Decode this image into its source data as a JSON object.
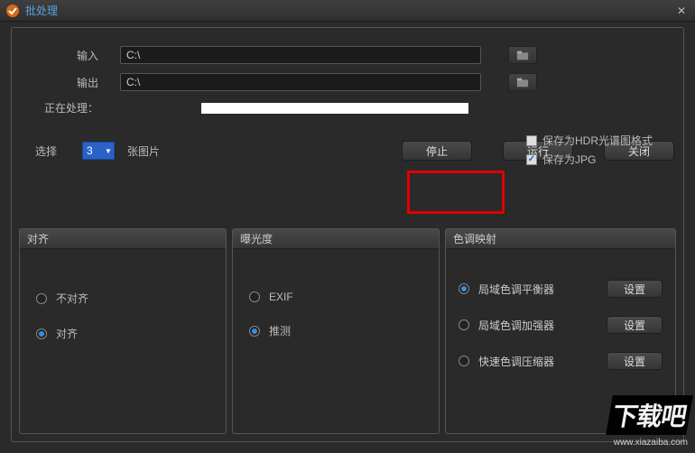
{
  "title": "批处理",
  "input": {
    "label": "输入",
    "value": "C:\\"
  },
  "output": {
    "label": "输出",
    "value": "C:\\"
  },
  "processing_label": "正在处理：",
  "save_hdr": {
    "label": "保存为HDR光谱图格式",
    "checked": false
  },
  "save_jpg": {
    "label": "保存为JPG",
    "checked": true
  },
  "select": {
    "label": "选择",
    "value": "3",
    "suffix": "张图片"
  },
  "buttons": {
    "stop": "停止",
    "run": "运行",
    "close": "关闭",
    "settings": "设置"
  },
  "panels": {
    "align": {
      "title": "对齐",
      "opt_no": "不对齐",
      "opt_yes": "对齐"
    },
    "exposure": {
      "title": "曝光度",
      "opt_exif": "EXIF",
      "opt_guess": "推测"
    },
    "tonemap": {
      "title": "色调映射",
      "opt1": "局域色调平衡器",
      "opt2": "局域色调加强器",
      "opt3": "快速色调压缩器"
    }
  },
  "watermark": {
    "brand": "下载吧",
    "url": "www.xiazaiba.com"
  }
}
